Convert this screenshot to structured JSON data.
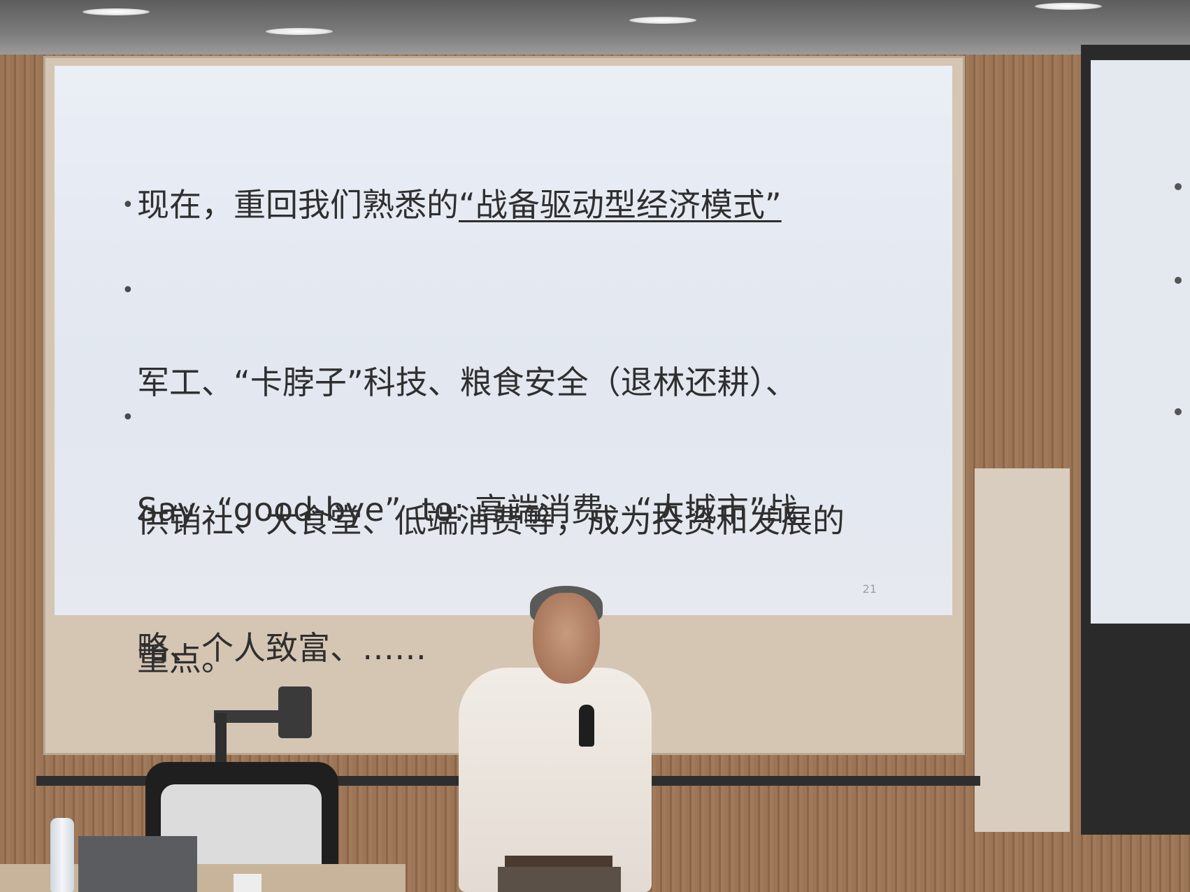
{
  "slide": {
    "bullets": [
      {
        "lines": [
          {
            "parts": [
              {
                "text": "现在，重回我们熟悉的",
                "underline": false
              },
              {
                "text": "“战备驱动型经济模式”",
                "underline": true
              }
            ]
          }
        ]
      },
      {
        "lines": [
          "军工、“卡脖子”科技、粮食安全（退林还耕）、",
          "供销社、大食堂、低端消费等，成为投资和发展的",
          "重点。"
        ]
      },
      {
        "lines": [
          "Say  “good-bye”  to: 高端消费、“大城市”战",
          "略、个人致富、……"
        ]
      }
    ],
    "page_number": "21"
  },
  "colors": {
    "slide_text": "#2f2f2f",
    "slide_background": "#e4e8f0",
    "wall": "#9b7556"
  }
}
